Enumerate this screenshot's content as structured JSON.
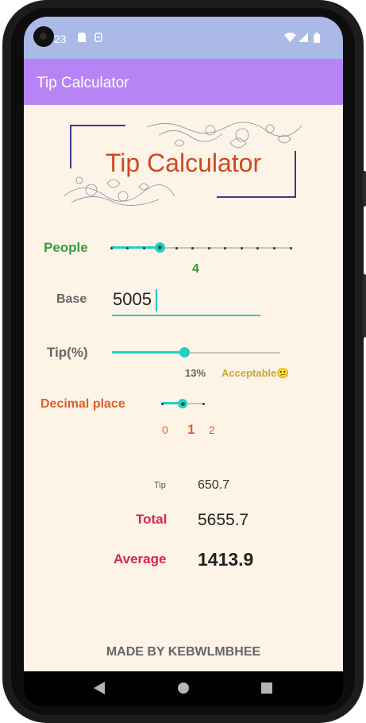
{
  "status_bar": {
    "time": "23",
    "icons": [
      "sd-card-icon",
      "storage-icon",
      "wifi-icon",
      "signal-icon",
      "battery-icon"
    ]
  },
  "app_bar": {
    "title": "Tip Calculator"
  },
  "hero": {
    "title": "Tip Calculator"
  },
  "people": {
    "label": "People",
    "value": "4",
    "slider_value": 4,
    "slider_min": 1,
    "slider_max": 12
  },
  "base": {
    "label": "Base",
    "value": "5005"
  },
  "tip": {
    "label": "Tip(%)",
    "value": "13%",
    "rating": "Acceptable",
    "emoji": "😕",
    "slider_fraction": 0.43
  },
  "decimal": {
    "label": "Decimal place",
    "options": [
      "0",
      "1",
      "2"
    ],
    "selected": 1
  },
  "results": {
    "tip_label": "Tip",
    "tip_value": "650.7",
    "total_label": "Total",
    "total_value": "5655.7",
    "average_label": "Average",
    "average_value": "1413.9"
  },
  "footer": {
    "credit": "MADE BY KEBWLMBHEE"
  },
  "colors": {
    "accent": "#1fd1c1",
    "people": "#3a9a3a",
    "decimal": "#e0602a",
    "results": "#d6245a",
    "appbar": "#b784f5",
    "statusbar": "#aab9e6",
    "background": "#fdf4e7"
  }
}
